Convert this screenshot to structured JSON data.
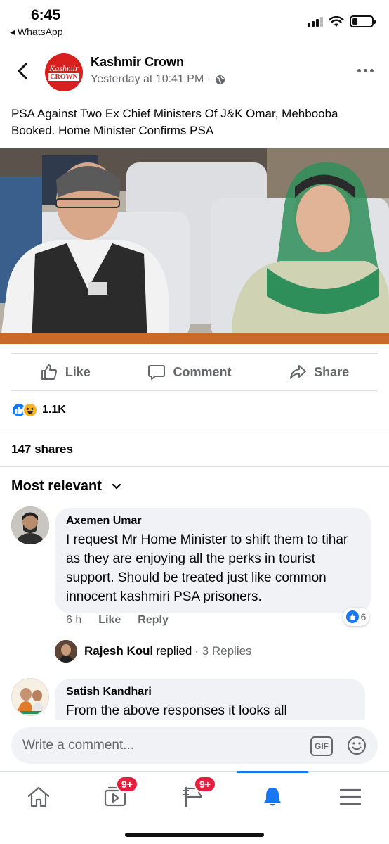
{
  "status_bar": {
    "time": "6:45",
    "back_app": "◂ WhatsApp",
    "battery_level": 0.25
  },
  "post": {
    "page_logo_line1": "Kashmir",
    "page_logo_line2": "CROWN",
    "page_name": "Kashmir Crown",
    "timestamp": "Yesterday at 10:41 PM ·",
    "text": "PSA Against Two Ex Chief Ministers Of J&K Omar, Mehbooba Booked. Home Minister Confirms PSA"
  },
  "actions": {
    "like": "Like",
    "comment": "Comment",
    "share": "Share"
  },
  "reactions": {
    "count": "1.1K"
  },
  "shares": "147 shares",
  "sort": {
    "label": "Most relevant"
  },
  "comments": [
    {
      "author": "Axemen Umar",
      "text": "I request Mr Home Minister to shift them to tihar as they are enjoying all the perks in tourist support. Should be treated just  like common innocent kashmiri PSA prisoners.",
      "time": "6 h",
      "like_label": "Like",
      "reply_label": "Reply",
      "likes": "6",
      "reply_summary": {
        "name": "Rajesh Koul",
        "verb": "replied",
        "count": "· 3 Replies"
      }
    },
    {
      "author": "Satish Kandhari",
      "text": "From the above responses it looks all"
    }
  ],
  "composer": {
    "placeholder": "Write a comment...",
    "gif_label": "GIF"
  },
  "bottom_nav": {
    "watch_badge": "9+",
    "pages_badge": "9+"
  },
  "colors": {
    "accent": "#1877f2",
    "badge": "#e41e3f",
    "brand_red": "#d8201f"
  }
}
